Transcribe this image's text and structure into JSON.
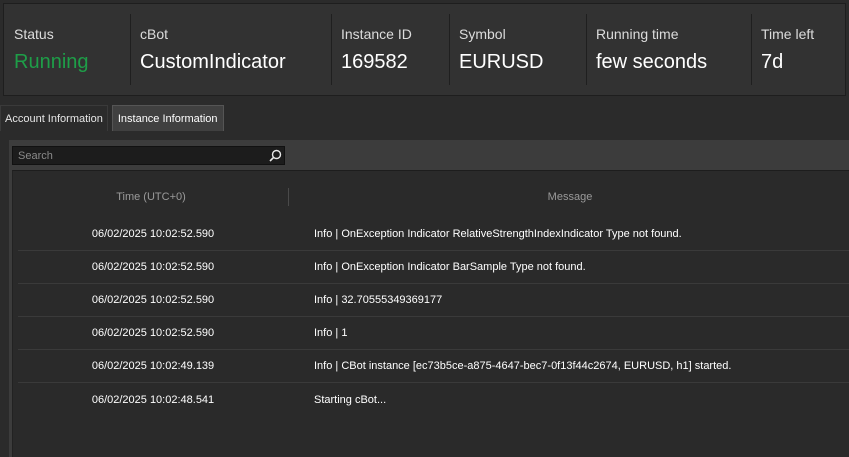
{
  "header": {
    "stats": [
      {
        "label": "Status",
        "value": "Running"
      },
      {
        "label": "cBot",
        "value": "CustomIndicator"
      },
      {
        "label": "Instance ID",
        "value": "169582"
      },
      {
        "label": "Symbol",
        "value": "EURUSD"
      },
      {
        "label": "Running time",
        "value": "few seconds"
      },
      {
        "label": "Time left",
        "value": "7d"
      }
    ]
  },
  "tabs": [
    {
      "label": "Account Information",
      "active": false
    },
    {
      "label": "Instance Information",
      "active": true
    }
  ],
  "search": {
    "placeholder": "Search",
    "value": "",
    "icon": "search-icon"
  },
  "table": {
    "columns": [
      "Time (UTC+0)",
      "Message"
    ],
    "rows": [
      {
        "time": "06/02/2025 10:02:52.590",
        "message": "Info | OnException Indicator RelativeStrengthIndexIndicator Type not found."
      },
      {
        "time": "06/02/2025 10:02:52.590",
        "message": "Info | OnException Indicator BarSample Type not found."
      },
      {
        "time": "06/02/2025 10:02:52.590",
        "message": "Info | 32.70555349369177"
      },
      {
        "time": "06/02/2025 10:02:52.590",
        "message": "Info | 1"
      },
      {
        "time": "06/02/2025 10:02:49.139",
        "message": "Info | CBot instance [ec73b5ce-a875-4647-bec7-0f13f44c2674, EURUSD, h1] started."
      },
      {
        "time": "06/02/2025 10:02:48.541",
        "message": "Starting cBot..."
      }
    ]
  },
  "colors": {
    "running": "#1e9e48",
    "background": "#2b2b2b",
    "header": "#323232"
  }
}
